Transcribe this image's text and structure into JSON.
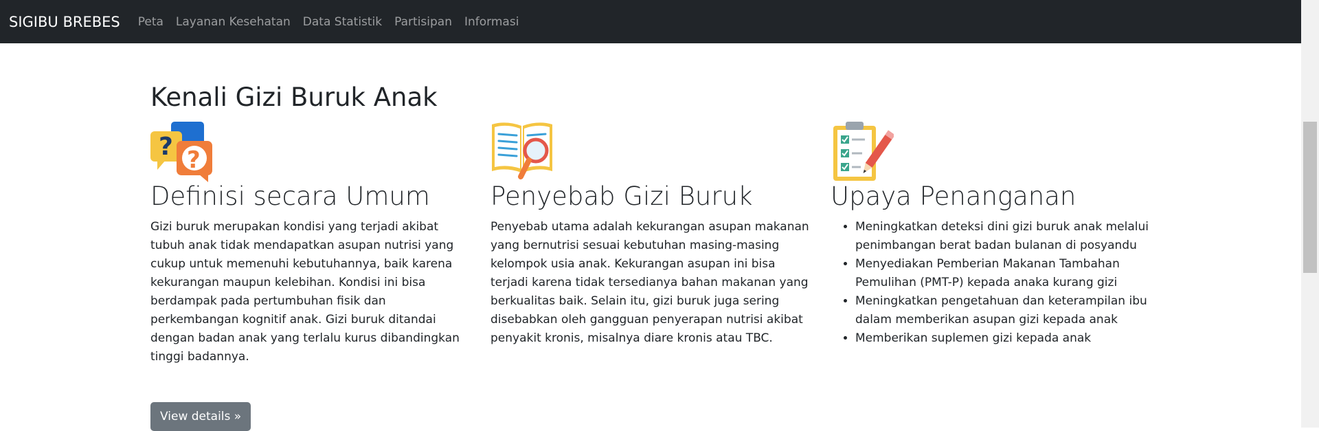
{
  "navbar": {
    "brand": "SIGIBU BREBES",
    "links": [
      {
        "label": "Peta"
      },
      {
        "label": "Layanan Kesehatan"
      },
      {
        "label": "Data Statistik"
      },
      {
        "label": "Partisipan"
      },
      {
        "label": "Informasi"
      }
    ]
  },
  "main": {
    "heading": "Kenali Gizi Buruk Anak",
    "columns": [
      {
        "icon": "question-bubbles-icon",
        "title": "Definisi secara Umum",
        "text": "Gizi buruk merupakan kondisi yang terjadi akibat tubuh anak tidak mendapatkan asupan nutrisi yang cukup untuk memenuhi kebutuhannya, baik karena kekurangan maupun kelebihan. Kondisi ini bisa berdampak pada pertumbuhan fisik dan perkembangan kognitif anak. Gizi buruk ditandai dengan badan anak yang terlalu kurus dibandingkan tinggi badannya.",
        "button": "View details »"
      },
      {
        "icon": "book-magnifier-icon",
        "title": "Penyebab Gizi Buruk",
        "text": "Penyebab utama adalah kekurangan asupan makanan yang bernutrisi sesuai kebutuhan masing-masing kelompok usia anak. Kekurangan asupan ini bisa terjadi karena tidak tersedianya bahan makanan yang berkualitas baik. Selain itu, gizi buruk juga sering disebabkan oleh gangguan penyerapan nutrisi akibat penyakit kronis, misalnya diare kronis atau TBC."
      },
      {
        "icon": "clipboard-checklist-icon",
        "title": "Upaya Penanganan",
        "items": [
          "Meningkatkan deteksi dini gizi buruk anak melalui penimbangan berat badan bulanan di posyandu",
          "Menyediakan Pemberian Makanan Tambahan Pemulihan (PMT-P) kepada anaka kurang gizi",
          "Meningkatkan pengetahuan dan keterampilan ibu dalam memberikan asupan gizi kepada anak",
          "Memberikan suplemen gizi kepada anak"
        ]
      }
    ]
  },
  "colors": {
    "navbar_bg": "#212529",
    "button_bg": "#6c757d",
    "text": "#212529"
  }
}
